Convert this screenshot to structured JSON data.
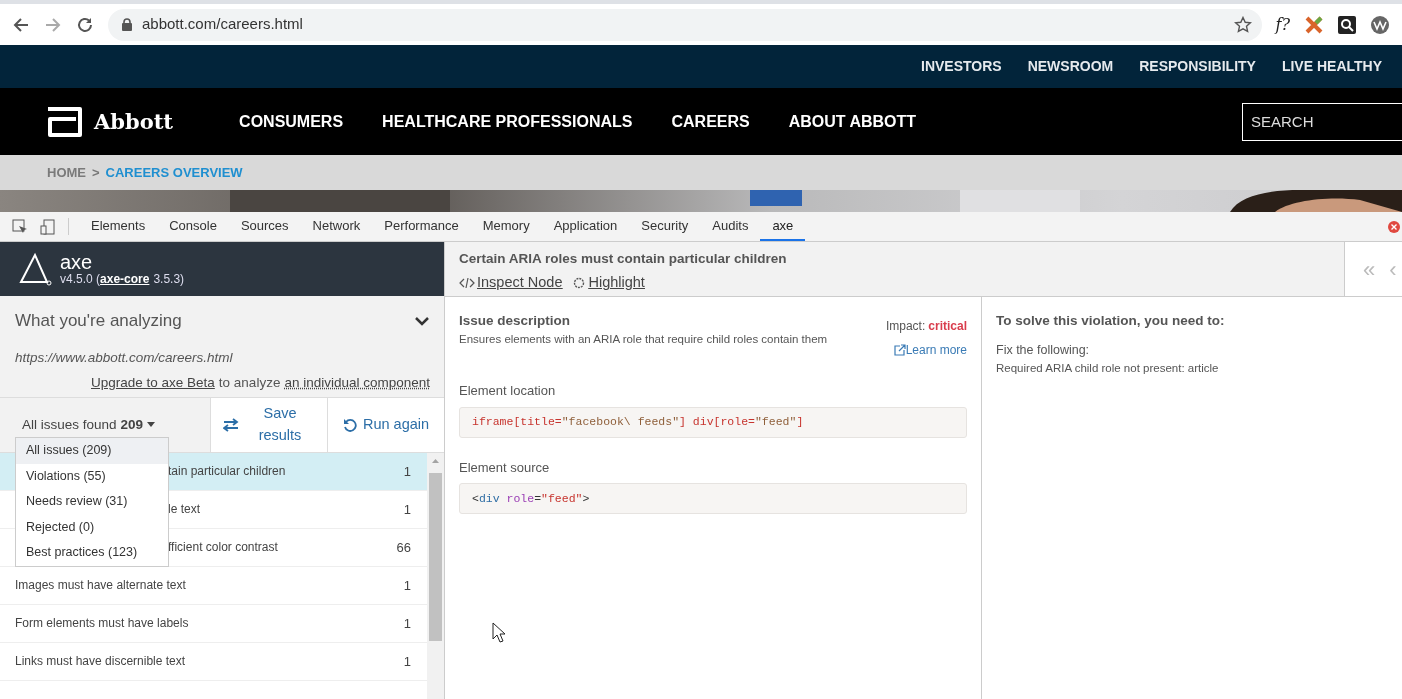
{
  "browser": {
    "url": "abbott.com/careers.html",
    "extension_label": "f?"
  },
  "site": {
    "utility_nav": [
      "INVESTORS",
      "NEWSROOM",
      "RESPONSIBILITY",
      "LIVE HEALTHY"
    ],
    "brand": "Abbott",
    "main_nav": [
      "CONSUMERS",
      "HEALTHCARE PROFESSIONALS",
      "CAREERS",
      "ABOUT ABBOTT"
    ],
    "search": {
      "placeholder": "SEARCH"
    },
    "breadcrumb": [
      {
        "label": "HOME",
        "selected": false
      },
      {
        "label": "CAREERS OVERVIEW",
        "selected": true
      }
    ],
    "breadcrumb_separator": ">"
  },
  "devtools": {
    "tabs": [
      {
        "label": "Elements",
        "selected": false
      },
      {
        "label": "Console",
        "selected": false
      },
      {
        "label": "Sources",
        "selected": false
      },
      {
        "label": "Network",
        "selected": false
      },
      {
        "label": "Performance",
        "selected": false
      },
      {
        "label": "Memory",
        "selected": false
      },
      {
        "label": "Application",
        "selected": false
      },
      {
        "label": "Security",
        "selected": false
      },
      {
        "label": "Audits",
        "selected": false
      },
      {
        "label": "axe",
        "selected": true
      }
    ]
  },
  "axe": {
    "name": "axe",
    "version_prefix": "v4.5.0 (",
    "core_link": "axe-core",
    "version_suffix": "3.5.3)",
    "analyzing": {
      "title": "What you're analyzing",
      "url": "https://www.abbott.com/careers.html",
      "upgrade_link": "Upgrade to axe Beta",
      "upgrade_text": "to analyze",
      "component_link": "an individual component"
    },
    "filter": {
      "label": "All issues found",
      "count": "209"
    },
    "buttons": [
      {
        "label": "Save results",
        "kind": "save"
      },
      {
        "label": "Run again",
        "kind": "rerun"
      }
    ],
    "filter_menu": [
      {
        "label": "All issues (209)",
        "selected": true
      },
      {
        "label": "Violations (55)",
        "selected": false
      },
      {
        "label": "Needs review (31)",
        "selected": false
      },
      {
        "label": "Rejected (0)",
        "selected": false
      },
      {
        "label": "Best practices (123)",
        "selected": false
      }
    ],
    "issues": [
      {
        "text": "tain particular children",
        "count": "1",
        "selected": true,
        "kind": "covered"
      },
      {
        "text": "le text",
        "count": "1",
        "selected": false,
        "kind": "covered"
      },
      {
        "text": "fficient color contrast",
        "count": "66",
        "selected": false,
        "kind": "covered"
      },
      {
        "text": "Images must have alternate text",
        "count": "1",
        "selected": false,
        "kind": "full"
      },
      {
        "text": "Form elements must have labels",
        "count": "1",
        "selected": false,
        "kind": "full"
      },
      {
        "text": "Links must have discernible text",
        "count": "1",
        "selected": false,
        "kind": "full"
      }
    ],
    "detail": {
      "title": "Certain ARIA roles must contain particular children",
      "actions": [
        {
          "label": "Inspect Node",
          "kind": "code"
        },
        {
          "label": "Highlight",
          "kind": "gear"
        }
      ],
      "issue_heading": "Issue description",
      "description": "Ensures elements with an ARIA role that require child roles contain them",
      "impact_label": "Impact:",
      "impact": "critical",
      "learn_more": "Learn more",
      "location_label": "Element location",
      "location_code": [
        {
          "text": "iframe[title=",
          "kind": "selector"
        },
        {
          "text": "\"facebook\\ feeds\"",
          "kind": "string"
        },
        {
          "text": "] div[role=",
          "kind": "selector"
        },
        {
          "text": "\"feed\"",
          "kind": "string"
        },
        {
          "text": "]",
          "kind": "selector"
        }
      ],
      "source_label": "Element source",
      "source_code": [
        {
          "text": "<",
          "kind": "punct"
        },
        {
          "text": "div",
          "kind": "tag"
        },
        {
          "text": " role",
          "kind": "attr"
        },
        {
          "text": "=",
          "kind": "punct"
        },
        {
          "text": "\"feed\"",
          "kind": "value"
        },
        {
          "text": ">",
          "kind": "punct"
        }
      ]
    },
    "solve": {
      "heading": "To solve this violation, you need to:",
      "lines": [
        "Fix the following:",
        "Required ARIA child role not present: article"
      ]
    },
    "pager": [
      "«",
      "‹"
    ]
  }
}
